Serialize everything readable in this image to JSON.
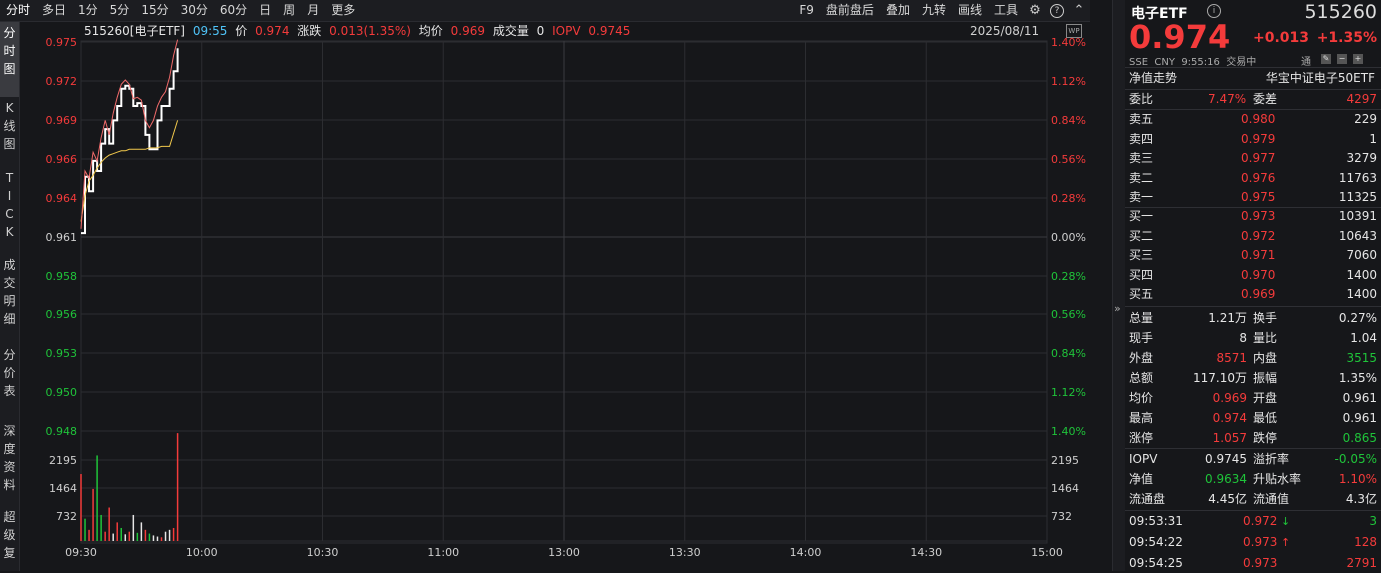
{
  "toolbar": {
    "left": [
      "分时",
      "多日",
      "1分",
      "5分",
      "15分",
      "30分",
      "60分",
      "日",
      "周",
      "月",
      "更多"
    ],
    "right": [
      "F9",
      "盘前盘后",
      "叠加",
      "九转",
      "画线",
      "工具"
    ],
    "icons": [
      "gear-icon",
      "help-icon",
      "chevron-up-icon"
    ]
  },
  "vtabs": [
    "分时图",
    "K线图",
    "TICK",
    "成交明细",
    "分价表",
    "深度资料",
    "超级复"
  ],
  "info": {
    "code": "515260[电子ETF]",
    "time": "09:55",
    "price_label": "价",
    "price": "0.974",
    "change_label": "涨跌",
    "change": "0.013(1.35%)",
    "avg_label": "均价",
    "avg": "0.969",
    "vol_label": "成交量",
    "vol": "0",
    "iopv_label": "IOPV",
    "iopv": "0.9745",
    "date": "2025/08/11",
    "wp_badge": "WP"
  },
  "chart_data": {
    "type": "line",
    "base_price": 0.961,
    "y_ticks_left": [
      "0.975",
      "0.972",
      "0.969",
      "0.966",
      "0.964",
      "0.961",
      "0.958",
      "0.956",
      "0.953",
      "0.950",
      "0.948"
    ],
    "y_ticks_right": [
      "1.40%",
      "1.12%",
      "0.84%",
      "0.56%",
      "0.28%",
      "0.00%",
      "0.28%",
      "0.56%",
      "0.84%",
      "1.12%",
      "1.40%"
    ],
    "volume_ticks": [
      "2195",
      "1464",
      "732"
    ],
    "x_ticks": [
      "09:30",
      "10:00",
      "10:30",
      "11:00",
      "13:00",
      "13:30",
      "14:00",
      "14:30",
      "15:00"
    ],
    "ylim": [
      0.9475,
      0.9745
    ],
    "series": [
      {
        "name": "价",
        "values": [
          0.9612,
          0.9651,
          0.9641,
          0.9662,
          0.9655,
          0.9674,
          0.9684,
          0.9674,
          0.969,
          0.97,
          0.9712,
          0.9714,
          0.9712,
          0.97,
          0.9702,
          0.97,
          0.968,
          0.967,
          0.967,
          0.969,
          0.97,
          0.97,
          0.9712,
          0.9724,
          0.974
        ]
      },
      {
        "name": "均价",
        "values": [
          0.962,
          0.9638,
          0.9648,
          0.9652,
          0.9657,
          0.9661,
          0.9664,
          0.9666,
          0.9667,
          0.9668,
          0.9669,
          0.9669,
          0.967,
          0.967,
          0.967,
          0.967,
          0.967,
          0.9671,
          0.9671,
          0.9671,
          0.9672,
          0.9672,
          0.9672,
          0.9681,
          0.969
        ]
      },
      {
        "name": "IOPV",
        "values": [
          0.9615,
          0.9655,
          0.965,
          0.9668,
          0.9662,
          0.9678,
          0.969,
          0.968,
          0.9695,
          0.9706,
          0.9715,
          0.9718,
          0.9715,
          0.9705,
          0.9706,
          0.9704,
          0.969,
          0.9685,
          0.969,
          0.97,
          0.9706,
          0.971,
          0.972,
          0.9735,
          0.9746
        ]
      }
    ],
    "volumes": [
      1800,
      600,
      300,
      1400,
      2300,
      700,
      250,
      900,
      200,
      500,
      350,
      180,
      250,
      700,
      220,
      500,
      300,
      200,
      150,
      120,
      100,
      250,
      300,
      350,
      2900
    ],
    "volume_max": 2930,
    "volume_colors": [
      "r",
      "g",
      "r",
      "r",
      "g",
      "g",
      "r",
      "r",
      "w",
      "r",
      "g",
      "w",
      "r",
      "w",
      "g",
      "w",
      "r",
      "g",
      "w",
      "w",
      "r",
      "w",
      "w",
      "r",
      "r"
    ]
  },
  "panel": {
    "name": "电子ETF",
    "code": "515260",
    "price": "0.974",
    "change": "+0.013",
    "change_pct": "+1.35%",
    "market": "SSE",
    "currency": "CNY",
    "time": "9:55:16",
    "status": "交易中",
    "tong": "通",
    "nav_trend": "净值走势",
    "tracking": "华宝中证电子50ETF",
    "weibi_label": "委比",
    "weibi": "7.47%",
    "weicha_label": "委差",
    "weicha": "4297",
    "asks": [
      {
        "label": "卖五",
        "price": "0.980",
        "vol": "229"
      },
      {
        "label": "卖四",
        "price": "0.979",
        "vol": "1"
      },
      {
        "label": "卖三",
        "price": "0.977",
        "vol": "3279"
      },
      {
        "label": "卖二",
        "price": "0.976",
        "vol": "11763"
      },
      {
        "label": "卖一",
        "price": "0.975",
        "vol": "11325"
      }
    ],
    "bids": [
      {
        "label": "买一",
        "price": "0.973",
        "vol": "10391"
      },
      {
        "label": "买二",
        "price": "0.972",
        "vol": "10643"
      },
      {
        "label": "买三",
        "price": "0.971",
        "vol": "7060"
      },
      {
        "label": "买四",
        "price": "0.970",
        "vol": "1400"
      },
      {
        "label": "买五",
        "price": "0.969",
        "vol": "1400"
      }
    ],
    "stats": [
      {
        "l1": "总量",
        "v1": "1.21万",
        "c1": "w",
        "l2": "换手",
        "v2": "0.27%",
        "c2": "w"
      },
      {
        "l1": "现手",
        "v1": "8",
        "c1": "w",
        "l2": "量比",
        "v2": "1.04",
        "c2": "w"
      },
      {
        "l1": "外盘",
        "v1": "8571",
        "c1": "r",
        "l2": "内盘",
        "v2": "3515",
        "c2": "g"
      },
      {
        "l1": "总额",
        "v1": "117.10万",
        "c1": "w",
        "l2": "振幅",
        "v2": "1.35%",
        "c2": "w"
      },
      {
        "l1": "均价",
        "v1": "0.969",
        "c1": "r",
        "l2": "开盘",
        "v2": "0.961",
        "c2": "w"
      },
      {
        "l1": "最高",
        "v1": "0.974",
        "c1": "r",
        "l2": "最低",
        "v2": "0.961",
        "c2": "w"
      },
      {
        "l1": "涨停",
        "v1": "1.057",
        "c1": "r",
        "l2": "跌停",
        "v2": "0.865",
        "c2": "g"
      }
    ],
    "stats2": [
      {
        "l1": "IOPV",
        "v1": "0.9745",
        "c1": "w",
        "l2": "溢折率",
        "v2": "-0.05%",
        "c2": "g"
      },
      {
        "l1": "净值",
        "v1": "0.9634",
        "c1": "g",
        "l2": "升贴水率",
        "v2": "1.10%",
        "c2": "r"
      },
      {
        "l1": "流通盘",
        "v1": "4.45亿",
        "c1": "w",
        "l2": "流通值",
        "v2": "4.3亿",
        "c2": "w"
      }
    ],
    "ticks": [
      {
        "time": "09:53:31",
        "price": "0.972",
        "dir": "down",
        "vol": "3",
        "c": "g"
      },
      {
        "time": "09:54:22",
        "price": "0.973",
        "dir": "up",
        "vol": "128",
        "c": "r"
      },
      {
        "time": "09:54:25",
        "price": "0.973",
        "dir": "",
        "vol": "2791",
        "c": "r"
      }
    ]
  },
  "colors": {
    "up": "#f43b3b",
    "down": "#1fc43a",
    "price_line": "#ffffff",
    "avg_line": "#f2c94c",
    "iopv_line": "#f06a6a",
    "grid": "#2c2d31"
  }
}
